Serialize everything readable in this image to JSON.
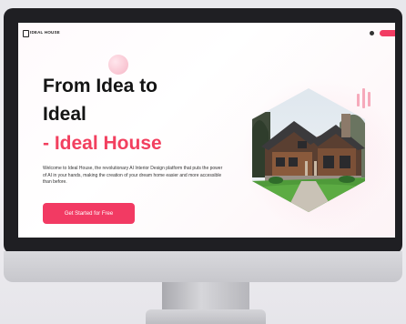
{
  "header": {
    "brand": "IDEAL HOUSE"
  },
  "hero": {
    "title_line1": "From Idea to",
    "title_line2": "Ideal",
    "title_line3": "- Ideal House",
    "description": "Welcome to Ideal House, the revolutionary AI Interior Design platform that puts the power of AI in your hands, making the creation of your dream home easier and more accessible than before.",
    "cta_label": "Get Started for Free"
  },
  "colors": {
    "accent": "#f23a63",
    "bezel": "#1f1f23"
  },
  "icons": [
    "logo-icon",
    "profile-icon",
    "house-image"
  ]
}
